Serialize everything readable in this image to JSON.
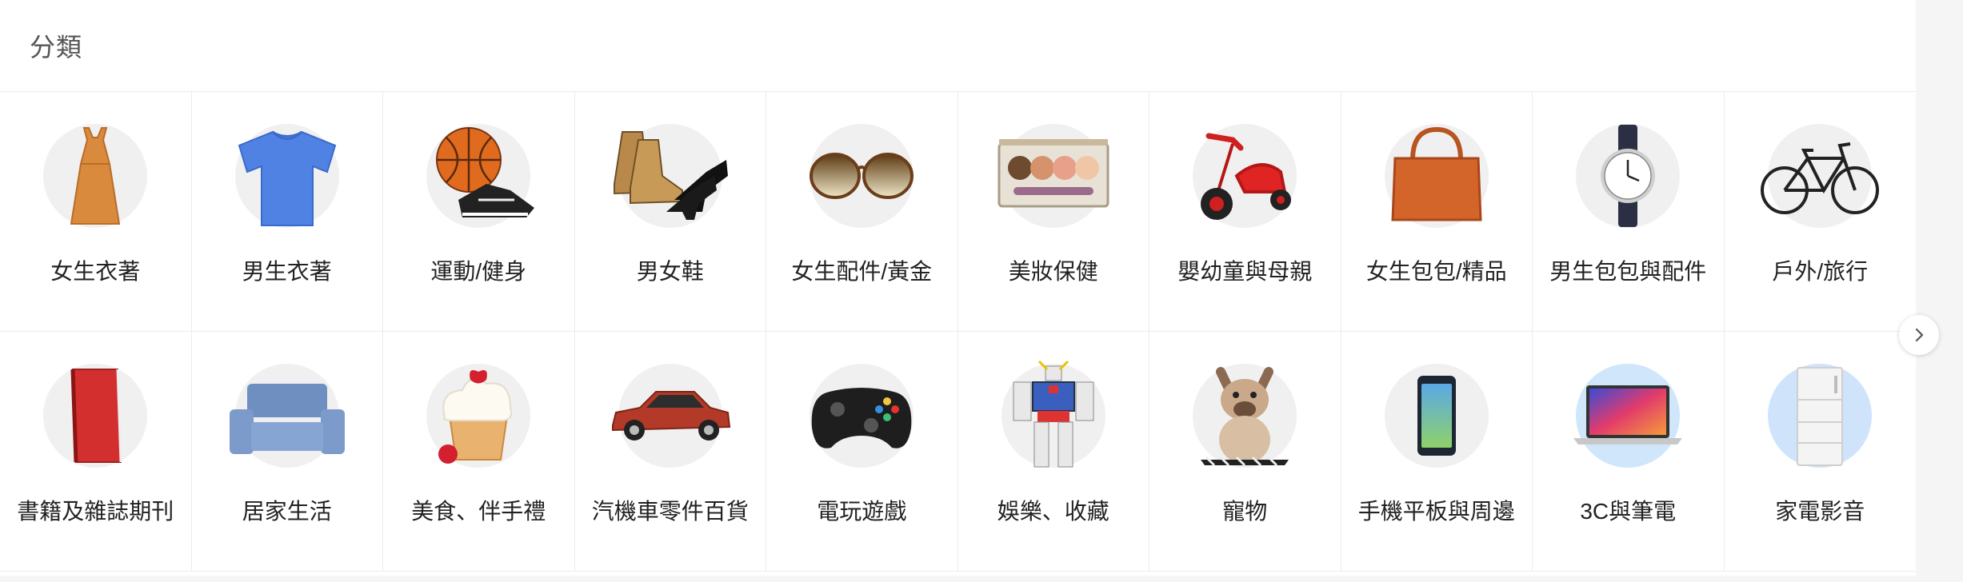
{
  "section": {
    "title": "分類"
  },
  "categories": [
    {
      "label": "女生衣著",
      "icon": "dress-icon"
    },
    {
      "label": "男生衣著",
      "icon": "tshirt-icon"
    },
    {
      "label": "運動/健身",
      "icon": "basketball-sneaker-icon"
    },
    {
      "label": "男女鞋",
      "icon": "shoes-icon"
    },
    {
      "label": "女生配件/黃金",
      "icon": "sunglasses-icon"
    },
    {
      "label": "美妝保健",
      "icon": "eyeshadow-palette-icon"
    },
    {
      "label": "嬰幼童與母親",
      "icon": "tricycle-icon"
    },
    {
      "label": "女生包包/精品",
      "icon": "handbag-icon"
    },
    {
      "label": "男生包包與配件",
      "icon": "wristwatch-icon"
    },
    {
      "label": "戶外/旅行",
      "icon": "bicycle-icon"
    },
    {
      "label": "書籍及雜誌期刊",
      "icon": "book-icon"
    },
    {
      "label": "居家生活",
      "icon": "sofa-icon"
    },
    {
      "label": "美食、伴手禮",
      "icon": "cupcake-icon"
    },
    {
      "label": "汽機車零件百貨",
      "icon": "car-icon"
    },
    {
      "label": "電玩遊戲",
      "icon": "game-controller-icon"
    },
    {
      "label": "娛樂、收藏",
      "icon": "robot-figure-icon"
    },
    {
      "label": "寵物",
      "icon": "dog-icon"
    },
    {
      "label": "手機平板與周邊",
      "icon": "smartphone-icon"
    },
    {
      "label": "3C與筆電",
      "icon": "laptop-icon"
    },
    {
      "label": "家電影音",
      "icon": "refrigerator-icon"
    }
  ],
  "controls": {
    "next_icon": "chevron-right-icon"
  },
  "colors": {
    "cell_border": "#ececec",
    "icon_circle": "#f0f0f0",
    "text": "#222222"
  }
}
